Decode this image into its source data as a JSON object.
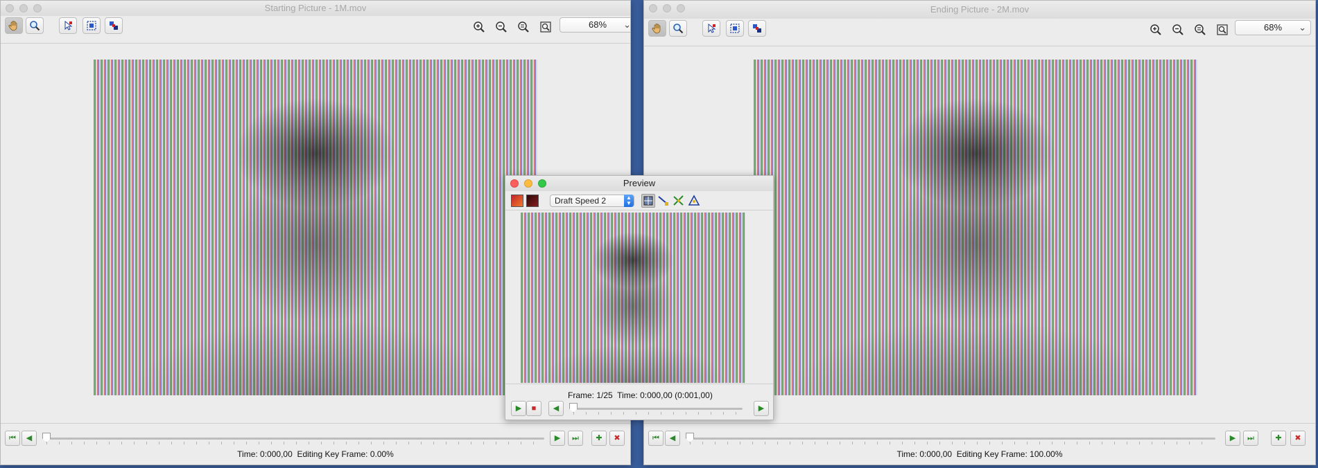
{
  "left_window": {
    "title": "Starting Picture - 1M.mov",
    "zoom": "68%",
    "status_time_label": "Time:",
    "status_time": "0:000,00",
    "status_key_label": "Editing Key Frame:",
    "status_key_value": "0.00%",
    "slider_position": 0.0
  },
  "right_window": {
    "title": "Ending Picture - 2M.mov",
    "zoom": "68%",
    "status_time_label": "Time:",
    "status_time": "0:000,00",
    "status_key_label": "Editing Key Frame:",
    "status_key_value": "100.00%",
    "slider_position": 0.0
  },
  "preview_window": {
    "title": "Preview",
    "quality": "Draft Speed 2",
    "frame_label": "Frame:",
    "frame_value": "1/25",
    "time_label": "Time:",
    "time_value": "0:000,00 (0:001,00)",
    "slider_position": 0.0
  },
  "colors": {
    "desktop": "#3a5f9e",
    "play_green": "#2a8a2a",
    "stop_red": "#c92a2a"
  },
  "icons": [
    "hand-tool-icon",
    "magnifier-tool-icon",
    "select-arrow-icon",
    "marquee-select-icon",
    "layers-icon",
    "zoom-in-icon",
    "zoom-out-icon",
    "zoom-actual-icon",
    "zoom-fit-icon",
    "play-icon",
    "stop-icon",
    "step-back-icon",
    "step-forward-icon",
    "go-start-icon",
    "go-end-icon",
    "add-key-icon",
    "delete-key-icon"
  ]
}
